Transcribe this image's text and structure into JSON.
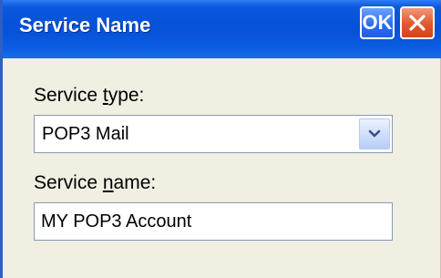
{
  "window": {
    "title": "Service Name",
    "ok_label": "OK"
  },
  "form": {
    "service_type": {
      "label_prefix": "Service ",
      "label_accel": "t",
      "label_suffix": "ype:",
      "selected": "POP3 Mail"
    },
    "service_name": {
      "label_prefix": "Service ",
      "label_accel": "n",
      "label_suffix": "ame:",
      "value": "MY POP3 Account"
    }
  },
  "icons": {
    "close": "close-icon",
    "dropdown": "chevron-down-icon"
  },
  "colors": {
    "titlebar": "#0551d8",
    "ok_button": "#2a6ff0",
    "close_button": "#e0572d",
    "dialog_background": "#f1eee2"
  }
}
